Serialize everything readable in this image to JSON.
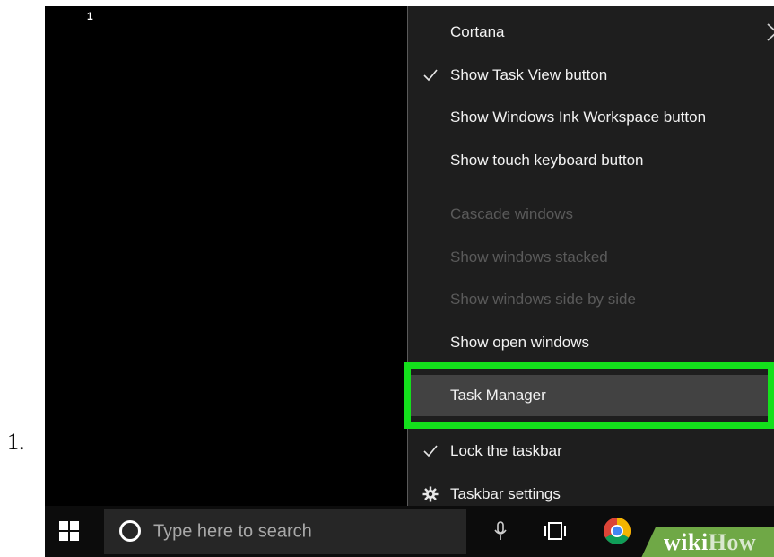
{
  "step_number": "1.",
  "desktop_badge": "1",
  "context_menu": {
    "items": [
      {
        "label": "Cortana",
        "checked": false,
        "disabled": false,
        "submenu": true
      },
      {
        "label": "Show Task View button",
        "checked": true,
        "disabled": false
      },
      {
        "label": "Show Windows Ink Workspace button",
        "checked": false,
        "disabled": false
      },
      {
        "label": "Show touch keyboard button",
        "checked": false,
        "disabled": false
      },
      {
        "label": "Cascade windows",
        "checked": false,
        "disabled": true
      },
      {
        "label": "Show windows stacked",
        "checked": false,
        "disabled": true
      },
      {
        "label": "Show windows side by side",
        "checked": false,
        "disabled": true
      },
      {
        "label": "Show open windows",
        "checked": false,
        "disabled": false
      },
      {
        "label": "Task Manager",
        "checked": false,
        "disabled": false,
        "highlighted": true
      },
      {
        "label": "Lock the taskbar",
        "checked": true,
        "disabled": false
      },
      {
        "label": "Taskbar settings",
        "checked": false,
        "disabled": false,
        "icon": "gear-icon"
      }
    ]
  },
  "taskbar": {
    "search_placeholder": "Type here to search",
    "icons": [
      "windows-start-icon",
      "cortana-circle-icon",
      "microphone-icon",
      "task-view-icon",
      "chrome-icon"
    ]
  },
  "watermark": {
    "part1": "wiki",
    "part2": "How"
  },
  "colors": {
    "highlight": "#14e01c",
    "menu_bg": "#1e1e1e",
    "taskbar_bg": "#0c0c0c",
    "search_bg": "#262626"
  }
}
